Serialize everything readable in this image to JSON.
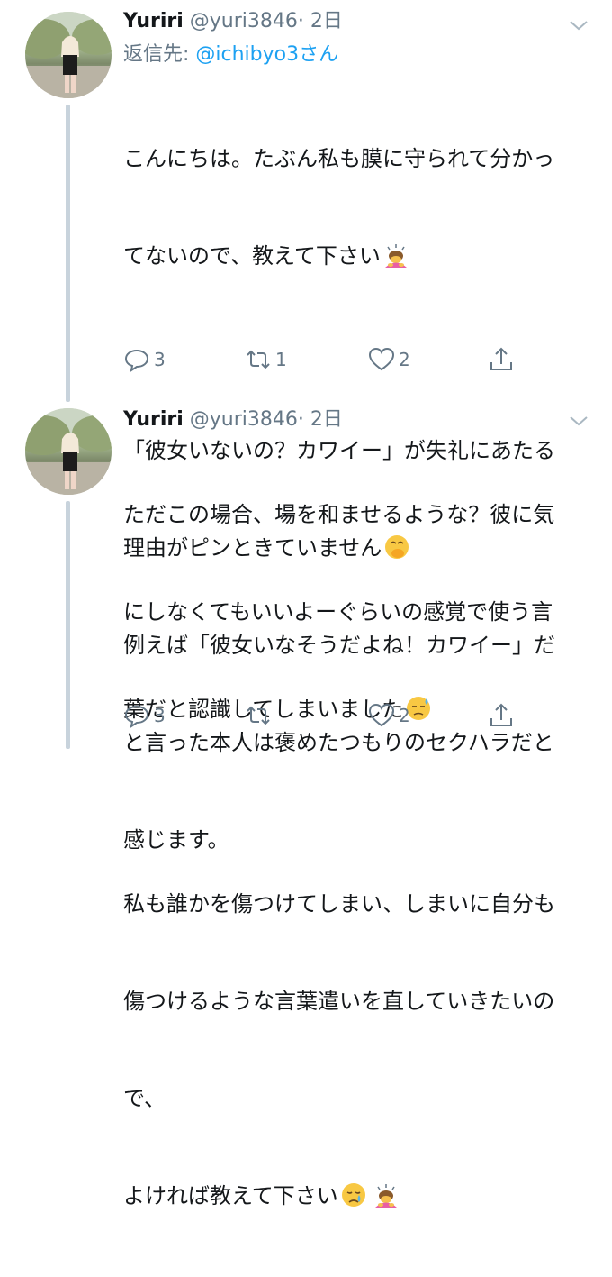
{
  "tweets": [
    {
      "name": "Yuriri",
      "handle": "@yuri3846",
      "time": "· 2日",
      "reply_prefix": "返信先: ",
      "reply_mention": "@ichibyo3さん",
      "text_lines": [
        "こんにちは。たぶん私も膜に守られて分かっ",
        "てないので、教えて下さい",
        "",
        "「彼女いないの？カワイー」が失礼にあたる",
        "理由がピンときていません",
        "例えば「彼女いなそうだよね！カワイー」だ",
        "と言った本人は褒めたつもりのセクハラだと",
        "感じます。"
      ],
      "reply_count": "3",
      "retweet_count": "1",
      "like_count": "2"
    },
    {
      "name": "Yuriri",
      "handle": "@yuri3846",
      "time": "· 2日",
      "text_lines": [
        "ただこの場合、場を和ませるような？彼に気",
        "にしなくてもいいよーぐらいの感覚で使う言",
        "葉だと認識してしまいました",
        "",
        "私も誰かを傷つけてしまい、しまいに自分も",
        "傷つけるような言葉遣いを直していきたいの",
        "で、",
        "よければ教えて下さい"
      ],
      "reply_count": "3",
      "retweet_count": "",
      "like_count": "2"
    }
  ],
  "icons": {
    "reply": "reply-icon",
    "retweet": "retweet-icon",
    "like": "heart-icon",
    "share": "share-icon",
    "menu": "chevron-down-icon",
    "emoji_bowing": "person-bowing-emoji",
    "emoji_hand_over_mouth": "hand-over-mouth-emoji",
    "emoji_sweat": "downcast-sweat-emoji",
    "emoji_cry": "crying-face-emoji"
  },
  "colors": {
    "name": "#14171a",
    "secondary": "#657786",
    "mention": "#1da1f2",
    "thread_line": "#c8d3dc"
  }
}
